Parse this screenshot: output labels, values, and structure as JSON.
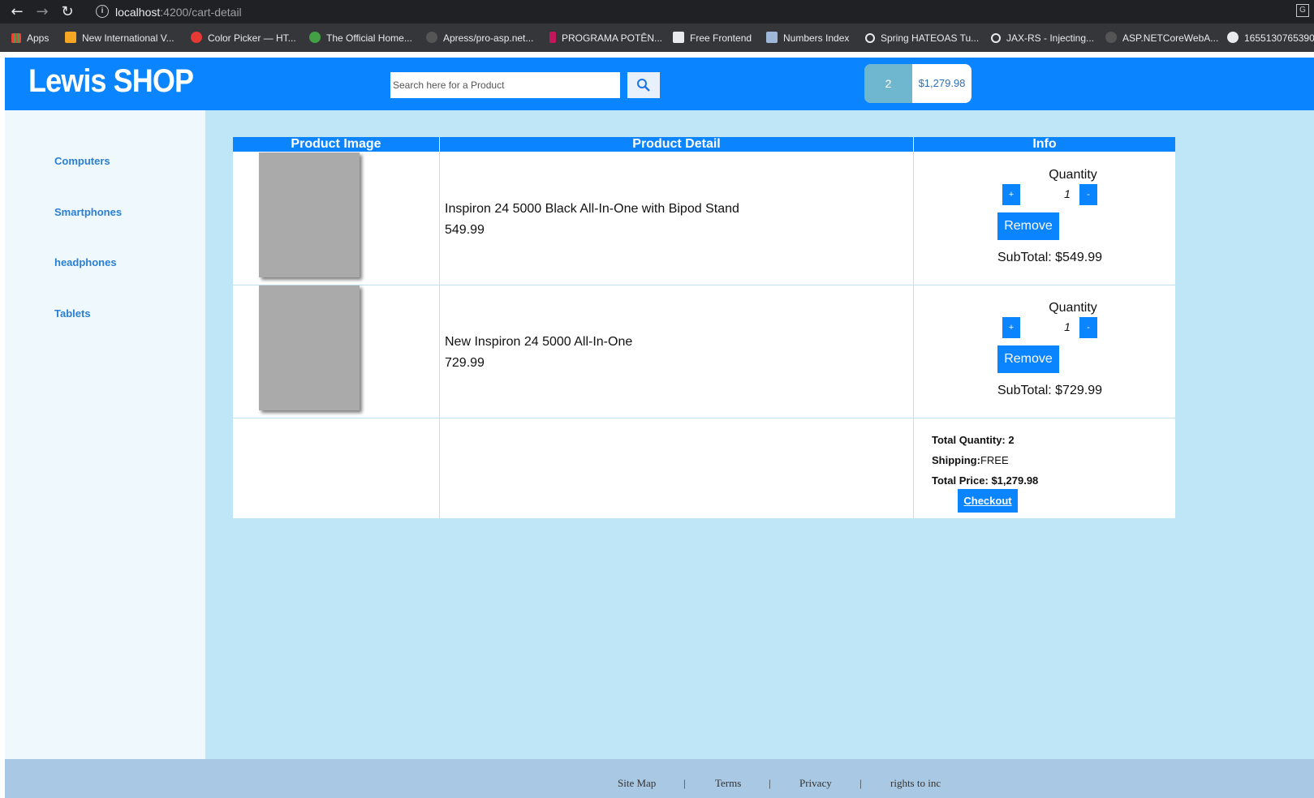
{
  "browser": {
    "url_host": "localhost",
    "url_path": ":4200/cart-detail",
    "bookmarks": [
      {
        "label": "Apps",
        "icon": "apps-grid-icon",
        "color": "#e8eaed"
      },
      {
        "label": "New International V...",
        "icon": "bookmark-favicon-icon",
        "color": "#f5a623"
      },
      {
        "label": "Color Picker — HT...",
        "icon": "bookmark-favicon-icon",
        "color": "#e53935"
      },
      {
        "label": "The Official Home...",
        "icon": "bookmark-favicon-icon",
        "color": "#43a047"
      },
      {
        "label": "Apress/pro-asp.net...",
        "icon": "github-icon",
        "color": "#444"
      },
      {
        "label": "PROGRAMA POTÊN...",
        "icon": "bookmark-favicon-icon",
        "color": "#c2185b"
      },
      {
        "label": "Free Frontend",
        "icon": "bookmark-favicon-icon",
        "color": "#e8eaed"
      },
      {
        "label": "Numbers Index",
        "icon": "bookmark-favicon-icon",
        "color": "#9fb7d9"
      },
      {
        "label": "Spring HATEOAS Tu...",
        "icon": "bookmark-favicon-icon",
        "color": "#e8eaed"
      },
      {
        "label": "JAX-RS - Injecting...",
        "icon": "bookmark-favicon-icon",
        "color": "#e8eaed"
      },
      {
        "label": "ASP.NETCoreWebA...",
        "icon": "github-icon",
        "color": "#444"
      },
      {
        "label": "1655130765390",
        "icon": "globe-icon",
        "color": "#e8eaed"
      }
    ]
  },
  "header": {
    "logo": "Lewis SHOP",
    "search_placeholder": "Search here for a Product",
    "cart_count": "2",
    "cart_total": "$1,279.98"
  },
  "sidebar": {
    "items": [
      {
        "label": "Computers"
      },
      {
        "label": "Smartphones"
      },
      {
        "label": "headphones"
      },
      {
        "label": "Tablets"
      }
    ]
  },
  "cart": {
    "columns": [
      "Product Image",
      "Product Detail",
      "Info"
    ],
    "items": [
      {
        "name": "Inspiron 24 5000 Black All-In-One with Bipod Stand",
        "price": "549.99",
        "quantity_label": "Quantity",
        "quantity": "1",
        "plus_label": "+",
        "minus_label": "-",
        "remove_label": "Remove",
        "subtotal": "SubTotal: $549.99"
      },
      {
        "name": "New Inspiron 24 5000 All-In-One",
        "price": "729.99",
        "quantity_label": "Quantity",
        "quantity": "1",
        "plus_label": "+",
        "minus_label": "-",
        "remove_label": "Remove",
        "subtotal": "SubTotal: $729.99"
      }
    ],
    "summary": {
      "total_quantity_label": "Total Quantity: 2",
      "shipping_label": "Shipping:",
      "shipping_value": "FREE",
      "total_price_label": "Total Price: $1,279.98",
      "checkout_label": "Checkout"
    }
  },
  "footer": {
    "links": [
      "Site Map",
      "Terms",
      "Privacy",
      "rights to inc"
    ],
    "separator": "|"
  },
  "colors": {
    "primary": "#0a84ff",
    "page_bg": "#bee6f7",
    "sidebar_bg": "#eff8fd",
    "footer_bg": "#a9c8e3"
  }
}
